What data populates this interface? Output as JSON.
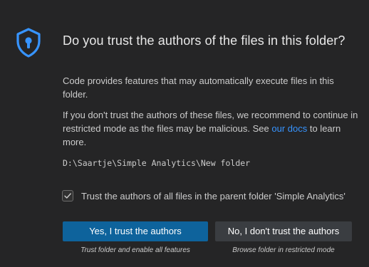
{
  "dialog": {
    "icon": "shield-lock-icon",
    "title": "Do you trust the authors of the files in this folder?",
    "paragraph1": "Code provides features that may automatically execute files in this folder.",
    "paragraph2_before": "If you don't trust the authors of these files, we recommend to continue in restricted mode as the files may be malicious. See ",
    "paragraph2_link": "our docs",
    "paragraph2_after": " to learn more.",
    "folder_path": "D:\\Saartje\\Simple Analytics\\New folder",
    "checkbox": {
      "checked": true,
      "label": "Trust the authors of all files in the parent folder 'Simple Analytics'"
    },
    "primary_button": {
      "label": "Yes, I trust the authors",
      "caption": "Trust folder and enable all features"
    },
    "secondary_button": {
      "label": "No, I don't trust the authors",
      "caption": "Browse folder in restricted mode"
    }
  },
  "colors": {
    "background": "#252526",
    "accent": "#0e639c",
    "icon": "#3794ff",
    "link": "#3794ff"
  }
}
